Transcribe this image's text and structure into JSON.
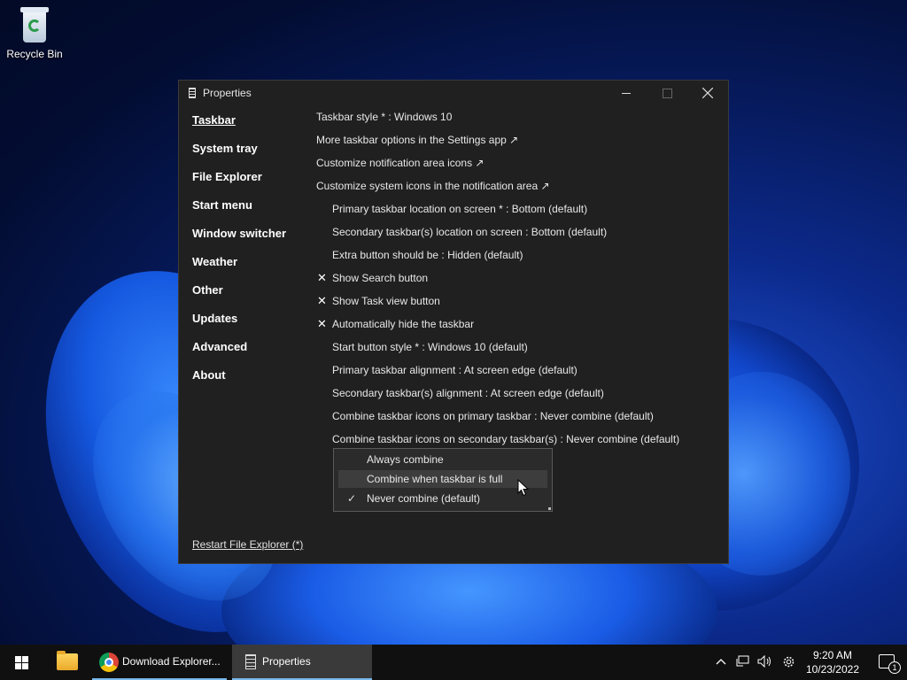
{
  "desktop": {
    "recycle_bin_label": "Recycle Bin"
  },
  "window": {
    "title": "Properties",
    "nav": [
      "Taskbar",
      "System tray",
      "File Explorer",
      "Start menu",
      "Window switcher",
      "Weather",
      "Other",
      "Updates",
      "Advanced",
      "About"
    ],
    "active_nav": "Taskbar",
    "settings": [
      {
        "label": "Taskbar style * : Windows 10"
      },
      {
        "label": "More taskbar options in the Settings app ↗"
      },
      {
        "label": "Customize notification area icons ↗"
      },
      {
        "label": "Customize system icons in the notification area ↗"
      },
      {
        "label": "Primary taskbar location on screen * : Bottom (default)"
      },
      {
        "label": "Secondary taskbar(s) location on screen : Bottom (default)"
      },
      {
        "label": "Extra button should be : Hidden (default)"
      },
      {
        "label": "Show Search button",
        "mark": "✕"
      },
      {
        "label": "Show Task view button",
        "mark": "✕"
      },
      {
        "label": "Automatically hide the taskbar",
        "mark": "✕"
      },
      {
        "label": "Start button style * : Windows 10 (default)"
      },
      {
        "label": "Primary taskbar alignment : At screen edge (default)"
      },
      {
        "label": "Secondary taskbar(s) alignment : At screen edge (default)"
      },
      {
        "label": "Combine taskbar icons on primary taskbar : Never combine (default)"
      },
      {
        "label": "Combine taskbar icons on secondary taskbar(s) : Never combine (default)"
      }
    ],
    "dropdown": {
      "options": [
        "Always combine",
        "Combine when taskbar is full",
        "Never combine (default)"
      ],
      "hovered": "Combine when taskbar is full",
      "selected": "Never combine (default)",
      "check_mark": "✓"
    },
    "restart_link": "Restart File Explorer (*)"
  },
  "taskbar": {
    "apps": [
      {
        "name": "File Explorer",
        "label": ""
      },
      {
        "name": "Chrome",
        "label": "Download Explorer..."
      },
      {
        "name": "Properties",
        "label": "Properties"
      }
    ],
    "clock_time": "9:20 AM",
    "clock_date": "10/23/2022",
    "notification_count": "1"
  }
}
